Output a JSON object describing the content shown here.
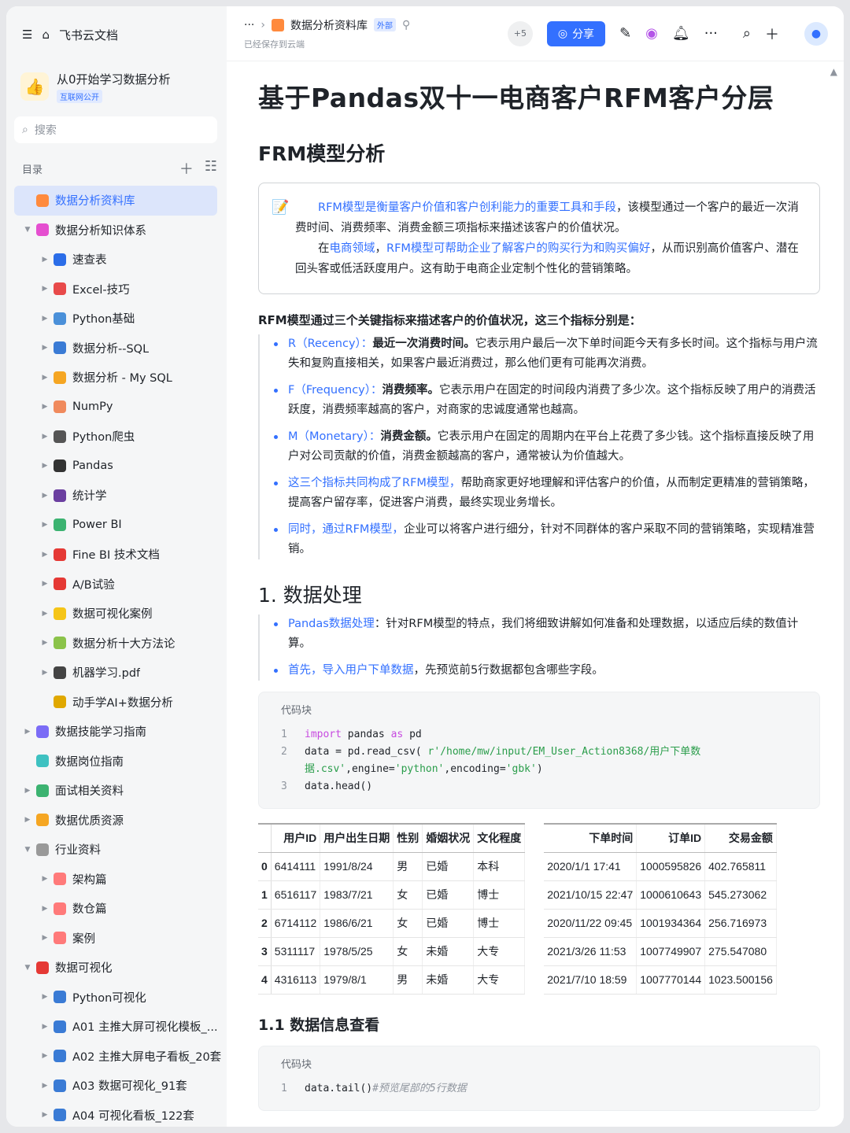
{
  "sidebar": {
    "app_title": "飞书云文档",
    "workspace": {
      "name": "从0开始学习数据分析",
      "badge": "互联网公开"
    },
    "search_placeholder": "搜索",
    "toc_label": "目录",
    "items": [
      {
        "label": "数据分析资料库",
        "indent": 1,
        "arrow": "",
        "icon_color": "#ff8a3d",
        "active": true
      },
      {
        "label": "数据分析知识体系",
        "indent": 1,
        "arrow": "▼",
        "icon_color": "#e54fd0"
      },
      {
        "label": "速查表",
        "indent": 2,
        "arrow": "▶",
        "icon_color": "#2b6de8"
      },
      {
        "label": "Excel-技巧",
        "indent": 2,
        "arrow": "▶",
        "icon_color": "#e84a4a"
      },
      {
        "label": "Python基础",
        "indent": 2,
        "arrow": "▶",
        "icon_color": "#4a90d9"
      },
      {
        "label": "数据分析--SQL",
        "indent": 2,
        "arrow": "▶",
        "icon_color": "#3a7bd5"
      },
      {
        "label": "数据分析 - My SQL",
        "indent": 2,
        "arrow": "▶",
        "icon_color": "#f5a623"
      },
      {
        "label": "NumPy",
        "indent": 2,
        "arrow": "▶",
        "icon_color": "#f08a5d"
      },
      {
        "label": "Python爬虫",
        "indent": 2,
        "arrow": "▶",
        "icon_color": "#555"
      },
      {
        "label": "Pandas",
        "indent": 2,
        "arrow": "▶",
        "icon_color": "#333"
      },
      {
        "label": "统计学",
        "indent": 2,
        "arrow": "▶",
        "icon_color": "#6b3fa0"
      },
      {
        "label": "Power BI",
        "indent": 2,
        "arrow": "▶",
        "icon_color": "#3cb371"
      },
      {
        "label": "Fine BI 技术文档",
        "indent": 2,
        "arrow": "▶",
        "icon_color": "#e53935"
      },
      {
        "label": "A/B试验",
        "indent": 2,
        "arrow": "▶",
        "icon_color": "#e53935"
      },
      {
        "label": "数据可视化案例",
        "indent": 2,
        "arrow": "▶",
        "icon_color": "#f5c518"
      },
      {
        "label": "数据分析十大方法论",
        "indent": 2,
        "arrow": "▶",
        "icon_color": "#8bc34a"
      },
      {
        "label": "机器学习.pdf",
        "indent": 2,
        "arrow": "▶",
        "icon_color": "#444"
      },
      {
        "label": "动手学AI+数据分析",
        "indent": 2,
        "arrow": "",
        "icon_color": "#e0a800"
      },
      {
        "label": "数据技能学习指南",
        "indent": 1,
        "arrow": "▶",
        "icon_color": "#7b6cf6"
      },
      {
        "label": "数据岗位指南",
        "indent": 1,
        "arrow": "",
        "icon_color": "#3ec1c1"
      },
      {
        "label": "面试相关资料",
        "indent": 1,
        "arrow": "▶",
        "icon_color": "#3cb371"
      },
      {
        "label": "数据优质资源",
        "indent": 1,
        "arrow": "▶",
        "icon_color": "#f5a623"
      },
      {
        "label": "行业资料",
        "indent": 1,
        "arrow": "▼",
        "icon_color": "#999"
      },
      {
        "label": "架构篇",
        "indent": 2,
        "arrow": "▶",
        "icon_color": "#ff7a7a"
      },
      {
        "label": "数仓篇",
        "indent": 2,
        "arrow": "▶",
        "icon_color": "#ff7a7a"
      },
      {
        "label": "案例",
        "indent": 2,
        "arrow": "▶",
        "icon_color": "#ff7a7a"
      },
      {
        "label": "数据可视化",
        "indent": 1,
        "arrow": "▼",
        "icon_color": "#e53935"
      },
      {
        "label": "Python可视化",
        "indent": 2,
        "arrow": "▶",
        "icon_color": "#3a7bd5"
      },
      {
        "label": "A01 主推大屏可视化模板_...",
        "indent": 2,
        "arrow": "▶",
        "icon_color": "#3a7bd5"
      },
      {
        "label": "A02 主推大屏电子看板_20套",
        "indent": 2,
        "arrow": "▶",
        "icon_color": "#3a7bd5"
      },
      {
        "label": "A03 数据可视化_91套",
        "indent": 2,
        "arrow": "▶",
        "icon_color": "#3a7bd5"
      },
      {
        "label": "A04 可视化看板_122套",
        "indent": 2,
        "arrow": "▶",
        "icon_color": "#3a7bd5"
      }
    ]
  },
  "topbar": {
    "ellipsis": "···",
    "crumb_title": "数据分析资料库",
    "crumb_badge": "外部",
    "saved": "已经保存到云端",
    "collab_count": "+5",
    "share_label": "分享"
  },
  "doc": {
    "title": "基于Pandas双十一电商客户RFM客户分层",
    "h_frm": "FRM模型分析",
    "callout": {
      "p1_blue": "RFM模型是衡量客户价值和客户创利能力的重要工具和手段",
      "p1_rest": "，该模型通过一个客户的最近一次消费时间、消费频率、消费金额三项指标来描述该客户的价值状况。",
      "p2_a": "在",
      "p2_blue1": "电商领域",
      "p2_b": "，",
      "p2_blue2": "RFM模型可帮助企业了解客户的购买行为和购买偏好",
      "p2_rest": "，从而识别高价值客户、潜在回头客或低活跃度用户。这有助于电商企业定制个性化的营销策略。"
    },
    "indicators_heading": "RFM模型通过三个关键指标来描述客户的价值状况，这三个指标分别是：",
    "bullets": [
      {
        "blue": "R（Recency）：",
        "bold": "最近一次消费时间。",
        "rest": "它表示用户最后一次下单时间距今天有多长时间。这个指标与用户流失和复购直接相关，如果客户最近消费过，那么他们更有可能再次消费。"
      },
      {
        "blue": "F（Frequency）：",
        "bold": "消费频率。",
        "rest": "它表示用户在固定的时间段内消费了多少次。这个指标反映了用户的消费活跃度，消费频率越高的客户，对商家的忠诚度通常也越高。"
      },
      {
        "blue": "M（Monetary）：",
        "bold": "消费金额。",
        "rest": "它表示用户在固定的周期内在平台上花费了多少钱。这个指标直接反映了用户对公司贡献的价值，消费金额越高的客户，通常被认为价值越大。"
      },
      {
        "blue": "这三个指标共同构成了RFM模型，",
        "bold": "",
        "rest": "帮助商家更好地理解和评估客户的价值，从而制定更精准的营销策略，提高客户留存率，促进客户消费，最终实现业务增长。"
      },
      {
        "blue": "同时，通过RFM模型，",
        "bold": "",
        "rest": "企业可以将客户进行细分，针对不同群体的客户采取不同的营销策略，实现精准营销。"
      }
    ],
    "h_data": "1. 数据处理",
    "data_bullets": [
      {
        "blue": "Pandas数据处理",
        "bold": "",
        "rest": "：针对RFM模型的特点，我们将细致讲解如何准备和处理数据，以适应后续的数值计算。"
      },
      {
        "blue": "首先，导入用户下单数据",
        "bold": "",
        "rest": "，先预览前5行数据都包含哪些字段。"
      }
    ],
    "code1": {
      "label": "代码块",
      "lines": [
        {
          "n": "1",
          "html": "<span class='kw'>import</span> pandas <span class='kw'>as</span> pd"
        },
        {
          "n": "2",
          "html": "data = pd.read_csv( <span class='str'>r'/home/mw/input/EM_User_Action8368/用户下单数</span>"
        },
        {
          "n": "",
          "html": "<span class='str'>据.csv'</span>,engine=<span class='str'>'python'</span>,encoding=<span class='str'>'gbk'</span>)"
        },
        {
          "n": "3",
          "html": "data.head()"
        }
      ]
    },
    "table_left": {
      "headers": [
        "",
        "用户ID",
        "用户出生日期",
        "性别",
        "婚姻状况",
        "文化程度"
      ],
      "rows": [
        [
          "0",
          "6414111",
          "1991/8/24",
          "男",
          "已婚",
          "本科"
        ],
        [
          "1",
          "6516117",
          "1983/7/21",
          "女",
          "已婚",
          "博士"
        ],
        [
          "2",
          "6714112",
          "1986/6/21",
          "女",
          "已婚",
          "博士"
        ],
        [
          "3",
          "5311117",
          "1978/5/25",
          "女",
          "未婚",
          "大专"
        ],
        [
          "4",
          "4316113",
          "1979/8/1",
          "男",
          "未婚",
          "大专"
        ]
      ]
    },
    "table_right": {
      "headers": [
        "下单时间",
        "订单ID",
        "交易金额"
      ],
      "rows": [
        [
          "2020/1/1 17:41",
          "1000595826",
          "402.765811"
        ],
        [
          "2021/10/15 22:47",
          "1000610643",
          "545.273062"
        ],
        [
          "2020/11/22 09:45",
          "1001934364",
          "256.716973"
        ],
        [
          "2021/3/26 11:53",
          "1007749907",
          "275.547080"
        ],
        [
          "2021/7/10 18:59",
          "1007770144",
          "1023.500156"
        ]
      ]
    },
    "h_info": "1.1 数据信息查看",
    "code2": {
      "label": "代码块",
      "lines": [
        {
          "n": "1",
          "html": "data.tail()<span class='cm'>#预览尾部的5行数据</span>"
        }
      ]
    }
  }
}
